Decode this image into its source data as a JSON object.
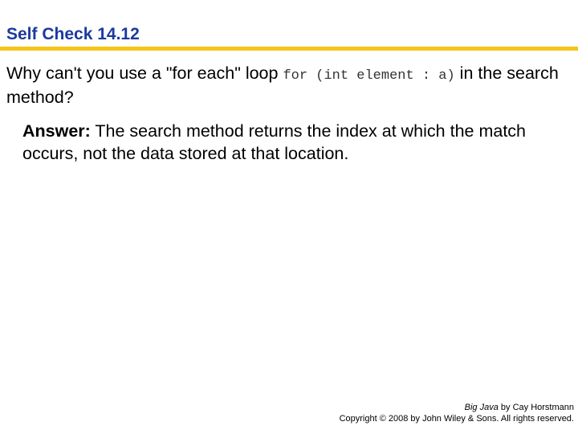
{
  "slide": {
    "title": "Self Check 14.12",
    "accent_color": "#f5c518",
    "title_color": "#1a3a9e"
  },
  "question": {
    "text_before": "Why can't you use a \"for each\" loop ",
    "code": "for (int element : a)",
    "text_after": " in the search method?"
  },
  "answer": {
    "label": "Answer:",
    "text": " The search method returns the index at which the match occurs, not the data stored at that location."
  },
  "footer": {
    "book_title": "Big Java",
    "author_line": " by Cay Horstmann",
    "copyright": "Copyright © 2008 by John Wiley & Sons.  All rights reserved."
  }
}
